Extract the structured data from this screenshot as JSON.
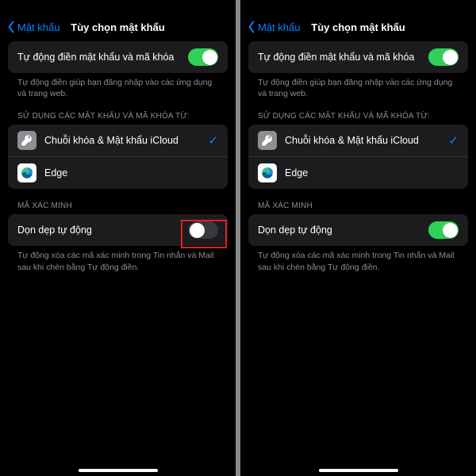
{
  "nav": {
    "back_label": "Mật khẩu",
    "title": "Tùy chọn mật khẩu"
  },
  "autofill": {
    "label": "Tự động điền mật khẩu và mã khóa",
    "footer": "Tự động điền giúp bạn đăng nhập vào các ứng dụng và trang web."
  },
  "sources_header": "SỬ DỤNG CÁC MẬT KHẨU VÀ MÃ KHÓA TỪ:",
  "sources": {
    "icloud": "Chuỗi khóa & Mật khẩu iCloud",
    "edge": "Edge"
  },
  "verification": {
    "header": "MÃ XÁC MINH",
    "cleanup_label": "Dọn dẹp tự động",
    "footer": "Tự động xóa các mã xác minh trong Tin nhắn và Mail sau khi chèn bằng Tự động điền."
  }
}
